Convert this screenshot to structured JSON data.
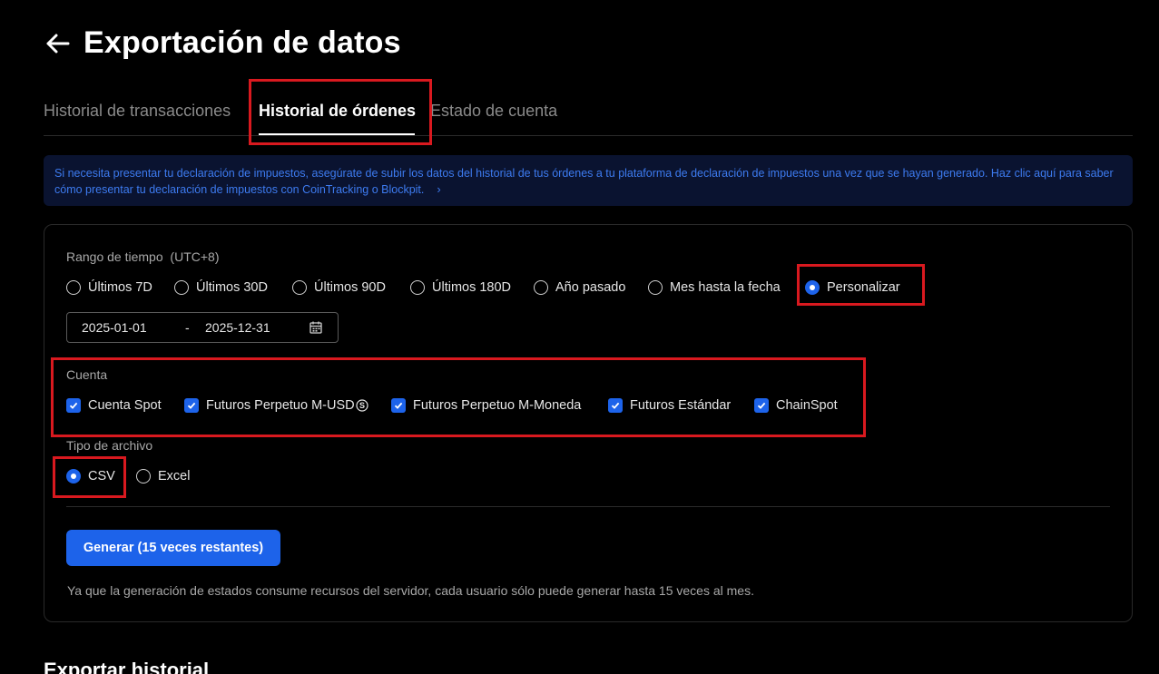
{
  "header": {
    "title": "Exportación de datos",
    "back_icon": "arrow-left-icon"
  },
  "tabs": [
    {
      "label": "Historial de transacciones",
      "active": false
    },
    {
      "label": "Historial de órdenes",
      "active": true
    },
    {
      "label": "Estado de cuenta",
      "active": false
    }
  ],
  "notice": {
    "text": "Si necesita presentar tu declaración de impuestos, asegúrate de subir los datos del historial de tus órdenes a tu plataforma de declaración de impuestos una vez que se hayan generado. Haz clic aquí para saber cómo presentar tu declaración de impuestos con CoinTracking o Blockpit.",
    "chevron": "›"
  },
  "time_range": {
    "label": "Rango de tiempo",
    "timezone": "(UTC+8)",
    "options": [
      {
        "label": "Últimos 7D",
        "selected": false
      },
      {
        "label": "Últimos 30D",
        "selected": false
      },
      {
        "label": "Últimos 90D",
        "selected": false
      },
      {
        "label": "Últimos 180D",
        "selected": false
      },
      {
        "label": "Año pasado",
        "selected": false
      },
      {
        "label": "Mes hasta la fecha",
        "selected": false
      },
      {
        "label": "Personalizar",
        "selected": true
      }
    ],
    "start_date": "2025-01-01",
    "separator": "-",
    "end_date": "2025-12-31"
  },
  "account": {
    "label": "Cuenta",
    "options": [
      {
        "label": "Cuenta Spot",
        "checked": true
      },
      {
        "label": "Futuros Perpetuo M-USD",
        "checked": true
      },
      {
        "label": "Futuros Perpetuo M-Moneda",
        "checked": true
      },
      {
        "label": "Futuros Estándar",
        "checked": true
      },
      {
        "label": "ChainSpot",
        "checked": true
      }
    ]
  },
  "file_type": {
    "label": "Tipo de archivo",
    "options": [
      {
        "label": "CSV",
        "selected": true
      },
      {
        "label": "Excel",
        "selected": false
      }
    ]
  },
  "generate_button": "Generar (15 veces restantes)",
  "footnote": "Ya que la generación de estados consume recursos del servidor, cada usuario sólo puede generar hasta 15 veces al mes.",
  "next_section_title": "Exportar historial",
  "colors": {
    "accent": "#1d63ea",
    "highlight_box": "#d9191f",
    "notice_text": "#3d7bf0",
    "background": "#000000"
  }
}
